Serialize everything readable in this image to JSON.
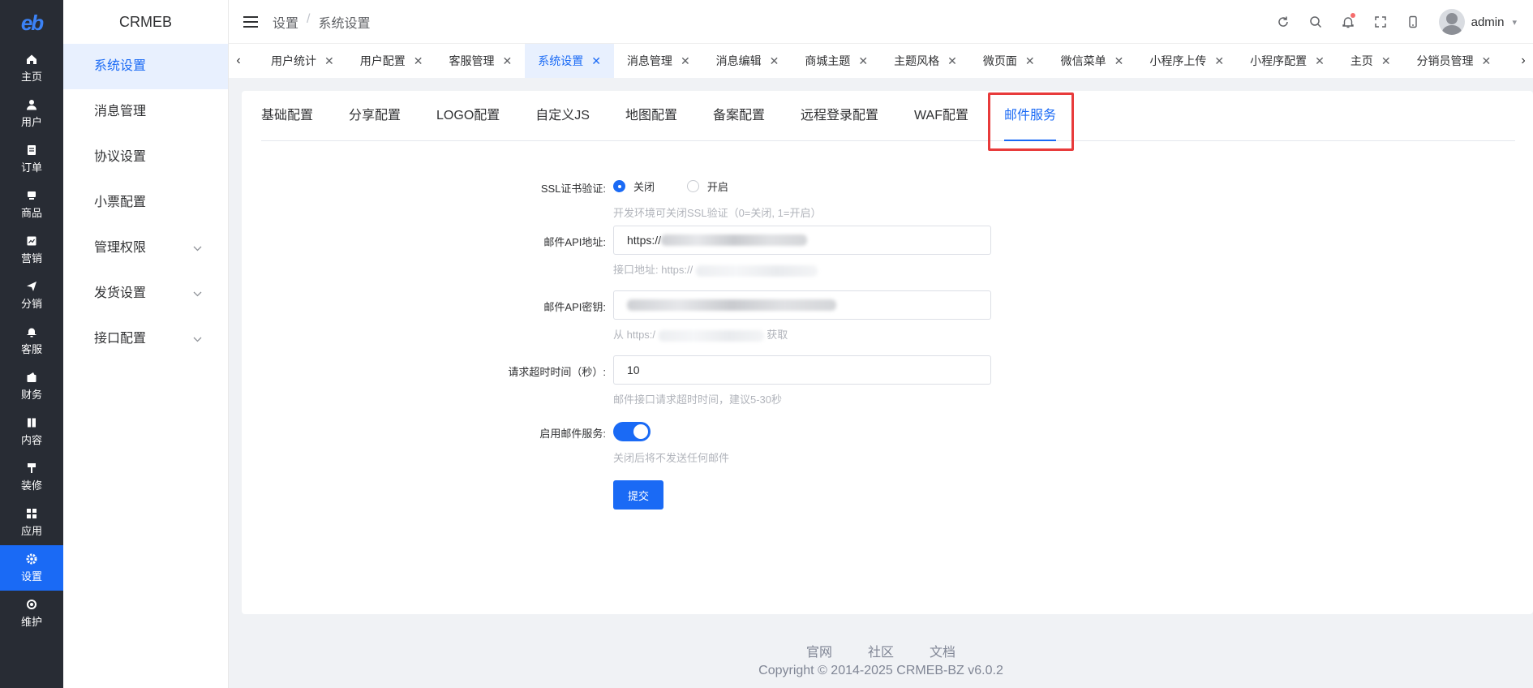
{
  "app": {
    "logo_text": "eb",
    "name": "CRMEB"
  },
  "rail": {
    "items": [
      {
        "label": "主页",
        "icon": "home-icon"
      },
      {
        "label": "用户",
        "icon": "user-icon"
      },
      {
        "label": "订单",
        "icon": "order-icon"
      },
      {
        "label": "商品",
        "icon": "product-icon"
      },
      {
        "label": "营销",
        "icon": "marketing-icon"
      },
      {
        "label": "分销",
        "icon": "distribution-icon"
      },
      {
        "label": "客服",
        "icon": "service-icon"
      },
      {
        "label": "财务",
        "icon": "finance-icon"
      },
      {
        "label": "内容",
        "icon": "content-icon"
      },
      {
        "label": "装修",
        "icon": "decorate-icon"
      },
      {
        "label": "应用",
        "icon": "apps-icon"
      },
      {
        "label": "设置",
        "icon": "settings-icon",
        "active": true
      },
      {
        "label": "维护",
        "icon": "maintenance-icon"
      }
    ]
  },
  "submenu": {
    "items": [
      {
        "label": "系统设置",
        "active": true
      },
      {
        "label": "消息管理"
      },
      {
        "label": "协议设置"
      },
      {
        "label": "小票配置"
      },
      {
        "label": "管理权限",
        "expandable": true
      },
      {
        "label": "发货设置",
        "expandable": true
      },
      {
        "label": "接口配置",
        "expandable": true
      }
    ]
  },
  "header": {
    "breadcrumb": [
      "设置",
      "系统设置"
    ],
    "breadcrumb_sep": "/",
    "username": "admin"
  },
  "tags": [
    {
      "label": "用户统计"
    },
    {
      "label": "用户配置"
    },
    {
      "label": "客服管理"
    },
    {
      "label": "系统设置",
      "active": true
    },
    {
      "label": "消息管理"
    },
    {
      "label": "消息编辑"
    },
    {
      "label": "商城主题"
    },
    {
      "label": "主题风格"
    },
    {
      "label": "微页面"
    },
    {
      "label": "微信菜单"
    },
    {
      "label": "小程序上传"
    },
    {
      "label": "小程序配置"
    },
    {
      "label": "主页"
    },
    {
      "label": "分销员管理"
    }
  ],
  "card_tabs": [
    {
      "label": "基础配置"
    },
    {
      "label": "分享配置"
    },
    {
      "label": "LOGO配置"
    },
    {
      "label": "自定义JS"
    },
    {
      "label": "地图配置"
    },
    {
      "label": "备案配置"
    },
    {
      "label": "远程登录配置"
    },
    {
      "label": "WAF配置"
    },
    {
      "label": "邮件服务",
      "active": true
    }
  ],
  "form": {
    "ssl": {
      "label": "SSL证书验证:",
      "options": [
        "关闭",
        "开启"
      ],
      "selected": "关闭",
      "hint": "开发环境可关闭SSL验证（0=关闭, 1=开启）"
    },
    "api_url": {
      "label": "邮件API地址:",
      "value_prefix": "https://",
      "hint_prefix": "接口地址: https://"
    },
    "api_key": {
      "label": "邮件API密钥:",
      "hint_prefix": "从 https:/",
      "hint_suffix": "获取"
    },
    "timeout": {
      "label": "请求超时时间（秒）:",
      "value": "10",
      "hint": "邮件接口请求超时时间，建议5-30秒"
    },
    "enable": {
      "label": "启用邮件服务:",
      "on": true,
      "hint": "关闭后将不发送任何邮件"
    },
    "submit_label": "提交"
  },
  "footer": {
    "links": [
      "官网",
      "社区",
      "文档"
    ],
    "copyright": "Copyright © 2014-2025 CRMEB-BZ v6.0.2"
  },
  "colors": {
    "accent": "#1a6af5",
    "rail_bg": "#282c34",
    "highlight": "#e83b3b"
  }
}
